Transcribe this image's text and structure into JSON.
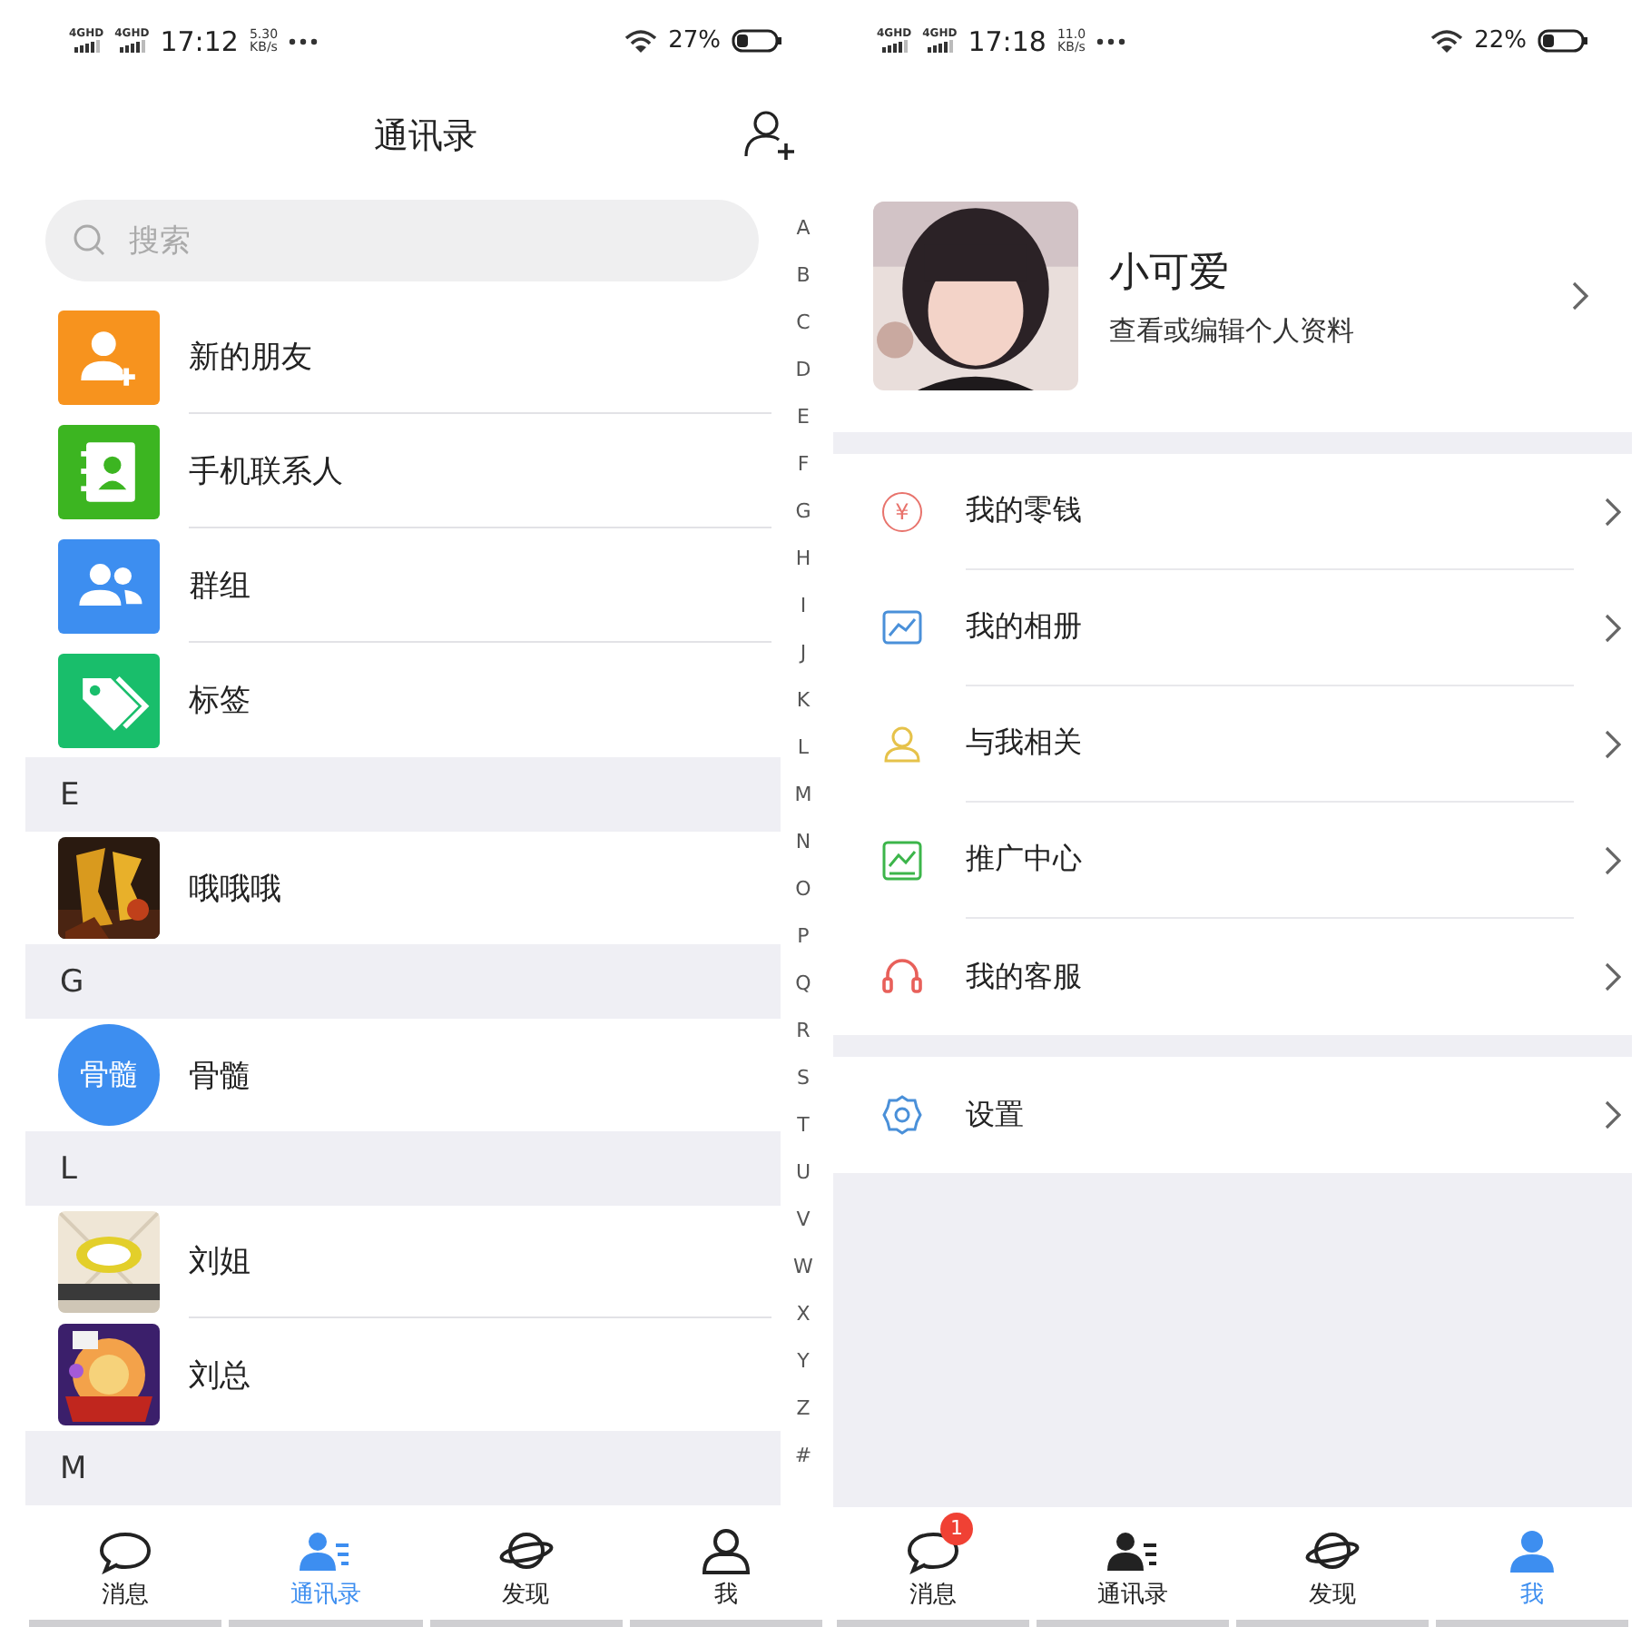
{
  "contacts_screen": {
    "status_bar": {
      "networks": [
        "4GHD",
        "4GHD"
      ],
      "time": "17:12",
      "speed": "5.30",
      "speed_unit": "KB/s",
      "battery": "27%"
    },
    "title": "通讯录",
    "search": {
      "placeholder": "搜索"
    },
    "features": [
      {
        "label": "新的朋友",
        "kind": "new-friend",
        "color": "#f7931e"
      },
      {
        "label": "手机联系人",
        "kind": "phone-contacts",
        "color": "#3cb521"
      },
      {
        "label": "群组",
        "kind": "group",
        "color": "#3d8ef0"
      },
      {
        "label": "标签",
        "kind": "tag",
        "color": "#19be6b"
      }
    ],
    "sections": [
      {
        "letter": "E",
        "contacts": [
          {
            "name": "哦哦哦"
          }
        ]
      },
      {
        "letter": "G",
        "contacts": [
          {
            "name": "骨髓",
            "avatar": {
              "kind": "initials",
              "text": "骨髓",
              "color": "#3d8ef0"
            }
          }
        ]
      },
      {
        "letter": "L",
        "contacts": [
          {
            "name": "刘姐"
          },
          {
            "name": "刘总"
          }
        ]
      },
      {
        "letter": "M"
      }
    ],
    "index_letters": [
      "A",
      "B",
      "C",
      "D",
      "E",
      "F",
      "G",
      "H",
      "I",
      "J",
      "K",
      "L",
      "M",
      "N",
      "O",
      "P",
      "Q",
      "R",
      "S",
      "T",
      "U",
      "V",
      "W",
      "X",
      "Y",
      "Z",
      "#"
    ],
    "tabs": [
      {
        "label": "消息",
        "kind": "chat",
        "selected": false
      },
      {
        "label": "通讯录",
        "kind": "contacts",
        "selected": true
      },
      {
        "label": "发现",
        "kind": "planet",
        "selected": false
      },
      {
        "label": "我",
        "kind": "person",
        "selected": false
      }
    ]
  },
  "profile_screen": {
    "status_bar": {
      "networks": [
        "4GHD",
        "4GHD"
      ],
      "time": "17:18",
      "speed": "11.0",
      "speed_unit": "KB/s",
      "battery": "22%"
    },
    "profile": {
      "name": "小可爱",
      "subtitle": "查看或编辑个人资料"
    },
    "menu_groups": [
      [
        {
          "label": "我的零钱",
          "kind": "coin",
          "icon_text": "¥",
          "color": "#e8736c"
        },
        {
          "label": "我的相册",
          "kind": "album",
          "color": "#4a90d9"
        },
        {
          "label": "与我相关",
          "kind": "person",
          "color": "#e6c24a"
        },
        {
          "label": "推广中心",
          "kind": "chart",
          "color": "#3cb54a"
        },
        {
          "label": "我的客服",
          "kind": "headset",
          "color": "#e8605a"
        }
      ],
      [
        {
          "label": "设置",
          "kind": "gear",
          "color": "#4a90d9"
        }
      ]
    ],
    "tabs": [
      {
        "label": "消息",
        "kind": "chat",
        "selected": false,
        "badge": "1"
      },
      {
        "label": "通讯录",
        "kind": "contacts",
        "selected": false
      },
      {
        "label": "发现",
        "kind": "planet",
        "selected": false
      },
      {
        "label": "我",
        "kind": "person",
        "selected": true
      }
    ]
  }
}
